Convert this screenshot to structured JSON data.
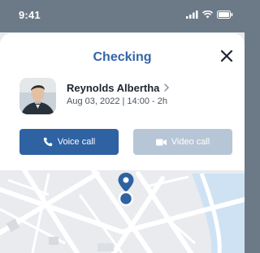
{
  "status_bar": {
    "time": "9:41",
    "icons": [
      "signal-icon",
      "wifi-icon",
      "battery-icon"
    ]
  },
  "sheet": {
    "title": "Checking",
    "close_icon": "close-icon"
  },
  "contact": {
    "name": "Reynolds Albertha",
    "meta": "Aug 03, 2022 | 14:00 - 2h"
  },
  "actions": {
    "voice_label": "Voice call",
    "video_label": "Video call"
  },
  "colors": {
    "accent": "#2f62a2",
    "title": "#3464a8",
    "disabled": "#b7c6d6",
    "pin": "#2f62a2",
    "header_bg": "#6c7a88"
  }
}
